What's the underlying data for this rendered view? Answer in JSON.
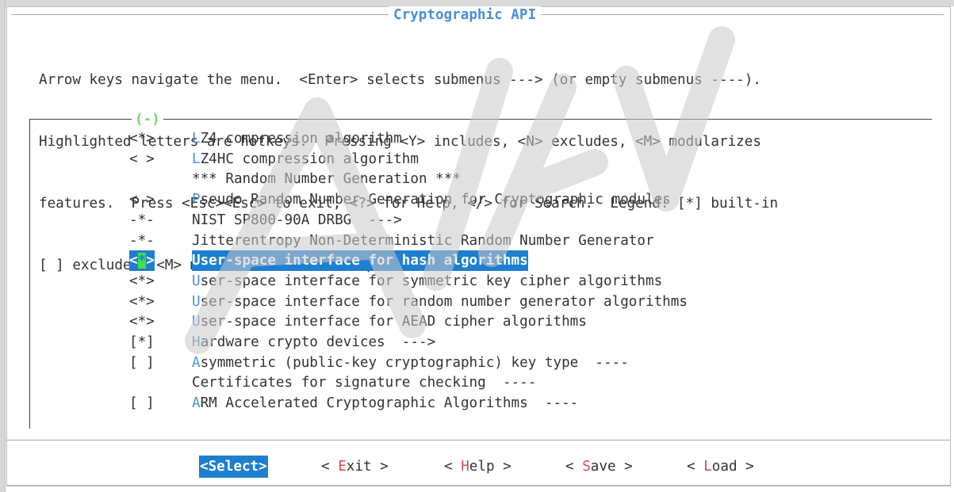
{
  "window": {
    "title": "Cryptographic API"
  },
  "help_lines": [
    "Arrow keys navigate the menu.  <Enter> selects submenus ---> (or empty submenus ----).",
    "Highlighted letters are hotkeys.  Pressing <Y> includes, <N> excludes, <M> modularizes",
    "features.  Press <Esc><Esc> to exit, <?> for Help, </> for Search.  Legend: [*] built-in",
    "[ ] excluded  <M> module  < > module capable"
  ],
  "scroll_indicator": "(-)",
  "menu_items": [
    {
      "mark": "<*>",
      "hotkey": "L",
      "rest": "Z4 compression algorithm",
      "selected": false
    },
    {
      "mark": "< >",
      "hotkey": "L",
      "rest": "Z4HC compression algorithm",
      "selected": false
    },
    {
      "mark": "",
      "hotkey": "",
      "rest": "*** Random Number Generation ***",
      "selected": false
    },
    {
      "mark": "< >",
      "hotkey": "P",
      "rest": "seudo Random Number Generation for Cryptographic modules",
      "selected": false
    },
    {
      "mark": "-*-",
      "hotkey": "",
      "rest": "NIST SP800-90A DRBG  --->",
      "selected": false
    },
    {
      "mark": "-*-",
      "hotkey": "",
      "rest": "Jitterentropy Non-Deterministic Random Number Generator",
      "selected": false
    },
    {
      "mark": "<*>",
      "hotkey": "U",
      "rest": "ser-space interface for hash algorithms",
      "selected": true
    },
    {
      "mark": "<*>",
      "hotkey": "U",
      "rest": "ser-space interface for symmetric key cipher algorithms",
      "selected": false
    },
    {
      "mark": "<*>",
      "hotkey": "U",
      "rest": "ser-space interface for random number generator algorithms",
      "selected": false
    },
    {
      "mark": "<*>",
      "hotkey": "U",
      "rest": "ser-space interface for AEAD cipher algorithms",
      "selected": false
    },
    {
      "mark": "[*]",
      "hotkey": "H",
      "rest": "ardware crypto devices  --->",
      "selected": false
    },
    {
      "mark": "[ ]",
      "hotkey": "A",
      "rest": "symmetric (public-key cryptographic) key type  ----",
      "selected": false
    },
    {
      "mark": "",
      "hotkey": "",
      "rest": "Certificates for signature checking  ----",
      "selected": false
    },
    {
      "mark": "[ ]",
      "hotkey": "A",
      "rest": "RM Accelerated Cryptographic Algorithms  ----",
      "selected": false
    }
  ],
  "buttons": [
    {
      "pre": "<",
      "hotkey": "Select",
      "post": ">",
      "active": true
    },
    {
      "pre": "< ",
      "hotkey": "E",
      "post": "xit >",
      "active": false
    },
    {
      "pre": "< ",
      "hotkey": "H",
      "post": "elp >",
      "active": false
    },
    {
      "pre": "< ",
      "hotkey": "S",
      "post": "ave >",
      "active": false
    },
    {
      "pre": "< ",
      "hotkey": "L",
      "post": "oad >",
      "active": false
    }
  ],
  "colors": {
    "accent": "#1e7fd1",
    "hotkey": "#4a8fd8",
    "button_hotkey": "#d64a4a",
    "cursor": "#3fe04a",
    "scroll_indicator": "#6fd36f"
  }
}
